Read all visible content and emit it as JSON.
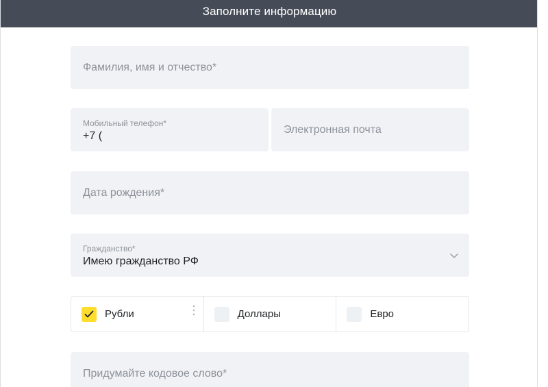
{
  "header": {
    "title": "Заполните информацию"
  },
  "form": {
    "full_name": {
      "placeholder": "Фамилия, имя и отчество*"
    },
    "phone": {
      "label": "Мобильный телефон*",
      "value": "+7 ("
    },
    "email": {
      "placeholder": "Электронная почта"
    },
    "birth_date": {
      "placeholder": "Дата рождения*"
    },
    "citizenship": {
      "label": "Гражданство*",
      "value": "Имею гражданство РФ"
    },
    "currencies": [
      {
        "label": "Рубли",
        "checked": true
      },
      {
        "label": "Доллары",
        "checked": false
      },
      {
        "label": "Евро",
        "checked": false
      }
    ],
    "code_word": {
      "placeholder": "Придумайте кодовое слово*"
    }
  },
  "icons": {
    "citizenship_chevron": "chevron-down-icon",
    "checkmark": "check-icon",
    "more": "vertical-dots-icon"
  },
  "colors": {
    "header_bg": "#464c57",
    "field_bg": "#f0f2f5",
    "checkbox_checked": "#ffdd2d",
    "placeholder_text": "#8d929a"
  }
}
